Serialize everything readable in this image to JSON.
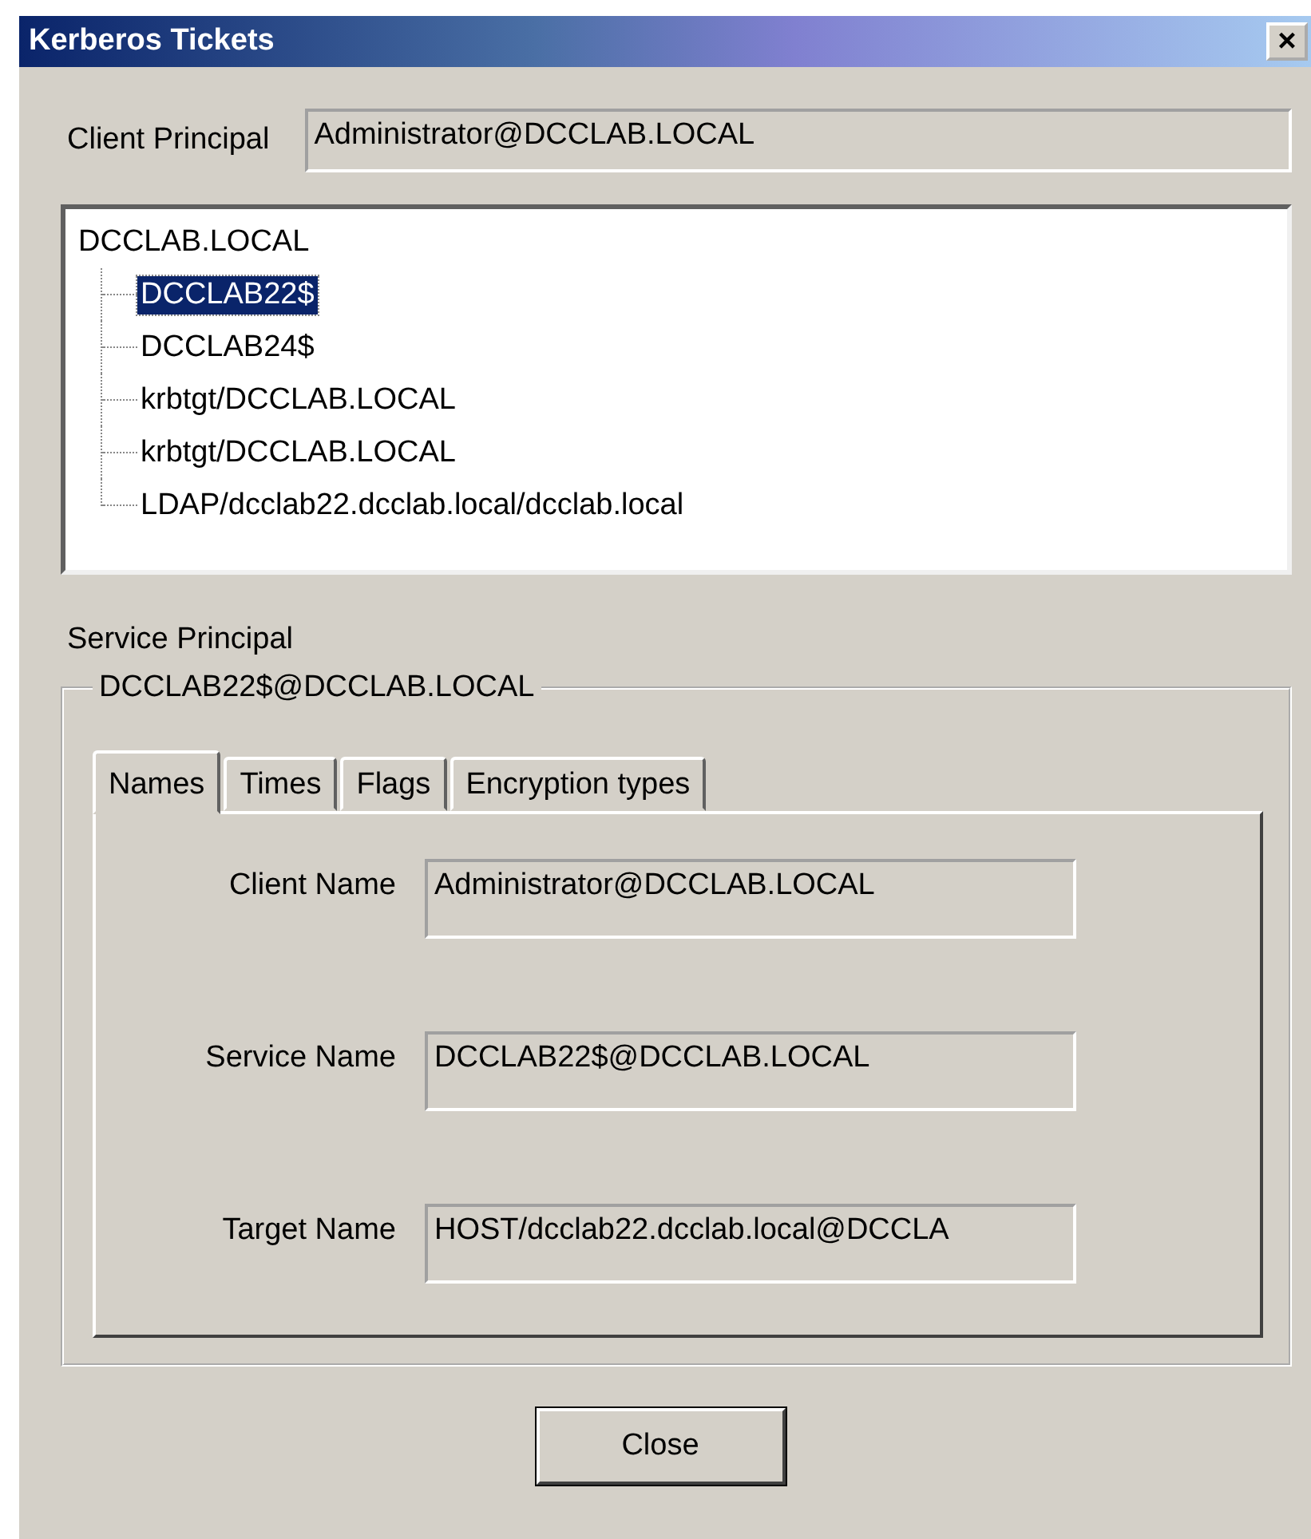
{
  "window": {
    "title": "Kerberos Tickets",
    "close": "×"
  },
  "client_principal": {
    "label": "Client Principal",
    "value": "Administrator@DCCLAB.LOCAL"
  },
  "tree": [
    {
      "label": "DCCLAB.LOCAL",
      "selected": false,
      "children": [
        {
          "label": "DCCLAB22$",
          "selected": true
        },
        {
          "label": "DCCLAB24$",
          "selected": false
        },
        {
          "label": "krbtgt/DCCLAB.LOCAL",
          "selected": false
        },
        {
          "label": "krbtgt/DCCLAB.LOCAL",
          "selected": false
        },
        {
          "label": "LDAP/dcclab22.dcclab.local/dcclab.local",
          "selected": false
        }
      ]
    }
  ],
  "service_principal": {
    "label": "Service Principal",
    "group_title": "DCCLAB22$@DCCLAB.LOCAL"
  },
  "tabs": [
    {
      "label": "Names",
      "selected": true
    },
    {
      "label": "Times",
      "selected": false
    },
    {
      "label": "Flags",
      "selected": false
    },
    {
      "label": "Encryption types",
      "selected": false
    }
  ],
  "fields": [
    {
      "label": "Client Name",
      "value": "Administrator@DCCLAB.LOCAL"
    },
    {
      "label": "Service Name",
      "value": "DCCLAB22$@DCCLAB.LOCAL"
    },
    {
      "label": "Target Name",
      "value": "HOST/dcclab22.dcclab.local@DCCLA"
    }
  ],
  "buttons": [
    {
      "label": "Close"
    }
  ]
}
